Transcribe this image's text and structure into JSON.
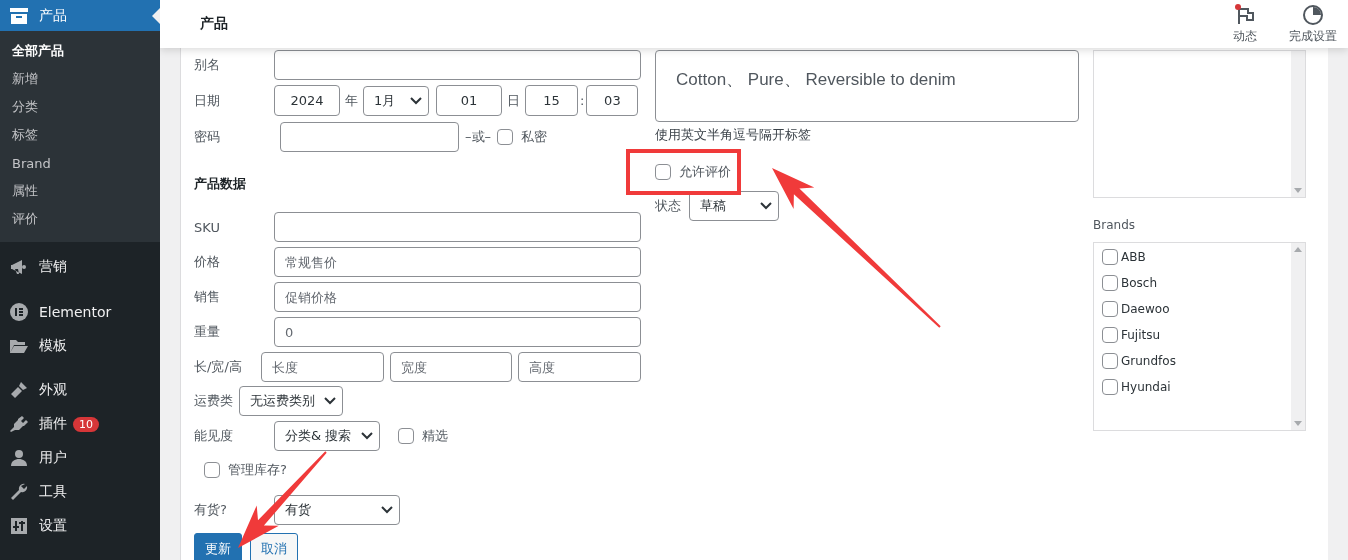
{
  "sidebar": {
    "current_menu": {
      "label": "产品",
      "selected": true
    },
    "submenu": [
      {
        "label": "全部产品",
        "selected": true
      },
      {
        "label": "新增",
        "selected": false
      },
      {
        "label": "分类",
        "selected": false
      },
      {
        "label": "标签",
        "selected": false
      },
      {
        "label": "Brand",
        "selected": false
      },
      {
        "label": "属性",
        "selected": false
      },
      {
        "label": "评价",
        "selected": false
      }
    ],
    "menu": [
      {
        "label": "营销"
      },
      {
        "label": "Elementor"
      },
      {
        "label": "模板"
      },
      {
        "label": "外观"
      },
      {
        "label": "插件",
        "badge": "10"
      },
      {
        "label": "用户"
      },
      {
        "label": "工具"
      },
      {
        "label": "设置"
      }
    ]
  },
  "header": {
    "title": "产品",
    "actions": [
      {
        "label": "动态",
        "notification": true
      },
      {
        "label": "完成设置",
        "notification": false
      }
    ]
  },
  "form": {
    "slug": {
      "label": "别名"
    },
    "date": {
      "label": "日期",
      "year": "2024",
      "year_suffix": "年",
      "month": "1月",
      "day": "01",
      "day_suffix": "日",
      "hour": "15",
      "separator": ":",
      "minute": "03"
    },
    "password": {
      "label": "密码",
      "or": "–或–",
      "private": {
        "label": "私密",
        "checked": false
      }
    },
    "product_data": {
      "heading": "产品数据",
      "fields": [
        {
          "label": "SKU"
        },
        {
          "label": "价格",
          "placeholder": "常规售价"
        },
        {
          "label": "销售",
          "placeholder": "促销价格"
        },
        {
          "label": "重量",
          "placeholder": "0"
        }
      ]
    },
    "dimensions": {
      "label": "长/宽/高",
      "placeholders": [
        "长度",
        "宽度",
        "高度"
      ]
    },
    "shipping_class": {
      "label": "运费类",
      "value": "无运费类别"
    },
    "visibility": {
      "label": "能见度",
      "value": "分类& 搜索",
      "featured": {
        "label": "精选",
        "checked": false
      }
    },
    "manage_stock": {
      "label": "管理库存?",
      "checked": false
    },
    "stock_status": {
      "label": "有货?",
      "value": "有货"
    },
    "buttons": [
      {
        "label": "更新",
        "primary": true
      },
      {
        "label": "取消",
        "primary": false
      }
    ],
    "tags": {
      "value": "Cotton、 Pure、 Reversible to denim",
      "hint": "使用英文半角逗号隔开标签"
    },
    "comments": {
      "label": "允许评价",
      "checked": false
    },
    "status": {
      "label": "状态",
      "value": "草稿"
    },
    "brands": {
      "label": "Brands",
      "items": [
        {
          "label": "ABB",
          "checked": false
        },
        {
          "label": "Bosch",
          "checked": false
        },
        {
          "label": "Daewoo",
          "checked": false
        },
        {
          "label": "Fujitsu",
          "checked": false
        },
        {
          "label": "Grundfos",
          "checked": false
        },
        {
          "label": "Hyundai",
          "checked": false
        }
      ]
    }
  },
  "annotations": [
    {
      "kind": "highlight-box"
    },
    {
      "kind": "arrow"
    },
    {
      "kind": "arrow"
    }
  ]
}
